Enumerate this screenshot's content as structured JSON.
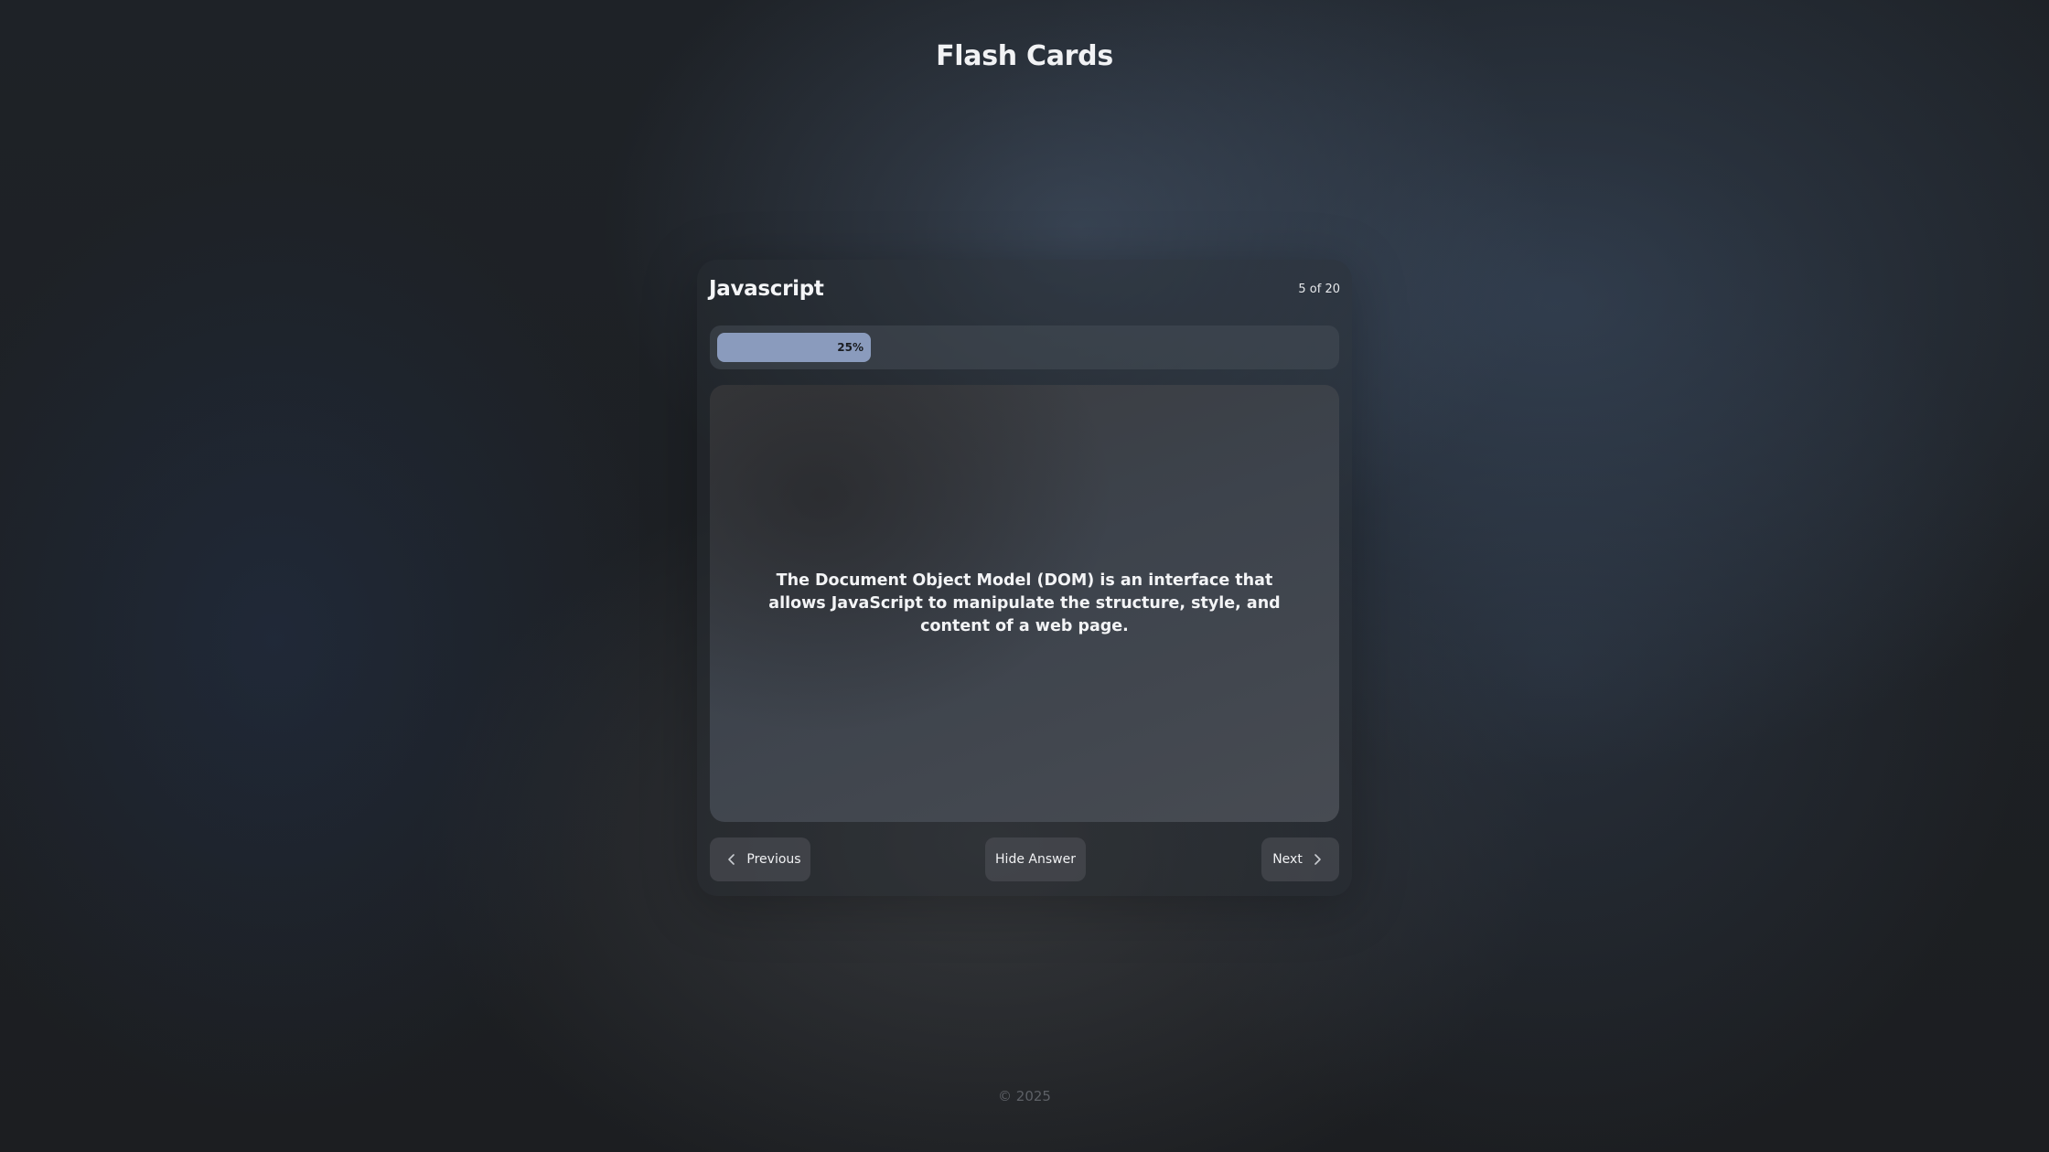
{
  "app": {
    "title": "Flash Cards"
  },
  "deck": {
    "name": "Javascript",
    "counter": "5 of 20"
  },
  "progress": {
    "value": 0.25,
    "label": "25%"
  },
  "card": {
    "text": "The Document Object Model (DOM) is an interface that allows JavaScript to manipulate the structure, style, and content of a web page."
  },
  "controls": {
    "previous_label": "Previous",
    "toggle_label": "Hide Answer",
    "next_label": "Next",
    "previous_icon": "chevron-left-icon",
    "next_icon": "chevron-right-icon"
  },
  "footer": {
    "text": "© 2025"
  },
  "colors": {
    "progress_fill": "#8a9bbd",
    "background": "#1b1c1e"
  }
}
